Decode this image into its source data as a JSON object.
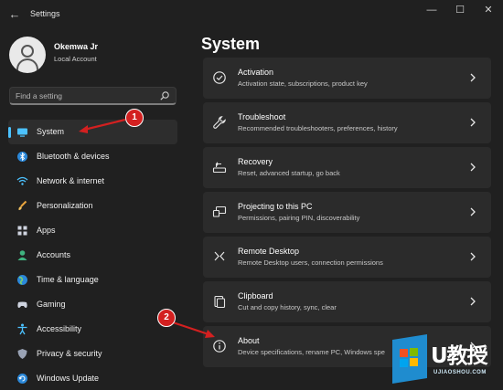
{
  "window": {
    "title": "Settings",
    "back_icon": "back-arrow-icon",
    "controls": [
      "minimize",
      "maximize",
      "close"
    ]
  },
  "profile": {
    "name": "Okemwa Jr",
    "account": "Local Account"
  },
  "search": {
    "placeholder": "Find a setting"
  },
  "sidebar": {
    "items": [
      {
        "label": "System",
        "icon": "system-icon",
        "active": true
      },
      {
        "label": "Bluetooth & devices",
        "icon": "bluetooth-icon"
      },
      {
        "label": "Network & internet",
        "icon": "wifi-icon"
      },
      {
        "label": "Personalization",
        "icon": "brush-icon"
      },
      {
        "label": "Apps",
        "icon": "apps-icon"
      },
      {
        "label": "Accounts",
        "icon": "accounts-icon"
      },
      {
        "label": "Time & language",
        "icon": "globe-icon"
      },
      {
        "label": "Gaming",
        "icon": "gaming-icon"
      },
      {
        "label": "Accessibility",
        "icon": "accessibility-icon"
      },
      {
        "label": "Privacy & security",
        "icon": "shield-icon"
      },
      {
        "label": "Windows Update",
        "icon": "update-icon"
      }
    ]
  },
  "main": {
    "title": "System",
    "cards": [
      {
        "title": "Activation",
        "subtitle": "Activation state, subscriptions, product key",
        "icon": "check-circle-icon"
      },
      {
        "title": "Troubleshoot",
        "subtitle": "Recommended troubleshooters, preferences, history",
        "icon": "wrench-icon"
      },
      {
        "title": "Recovery",
        "subtitle": "Reset, advanced startup, go back",
        "icon": "recovery-icon"
      },
      {
        "title": "Projecting to this PC",
        "subtitle": "Permissions, pairing PIN, discoverability",
        "icon": "projector-icon"
      },
      {
        "title": "Remote Desktop",
        "subtitle": "Remote Desktop users, connection permissions",
        "icon": "remote-desktop-icon"
      },
      {
        "title": "Clipboard",
        "subtitle": "Cut and copy history, sync, clear",
        "icon": "clipboard-icon"
      },
      {
        "title": "About",
        "subtitle": "Device specifications, rename PC, Windows spe",
        "icon": "info-icon"
      }
    ]
  },
  "annotations": [
    {
      "number": "1",
      "color": "#d32020"
    },
    {
      "number": "2",
      "color": "#d32020"
    }
  ],
  "watermark": {
    "text": "U教授",
    "sub": "UJIAOSHOU.COM"
  },
  "colors": {
    "background": "#202020",
    "card": "#2b2b2b",
    "accent": "#4cc2ff",
    "annotation": "#d32020"
  }
}
